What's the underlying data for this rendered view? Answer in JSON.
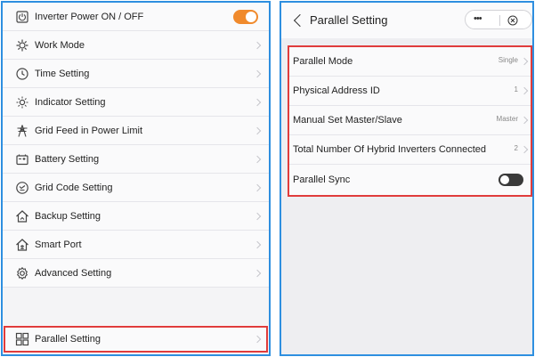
{
  "left_menu": {
    "items": [
      {
        "label": "Inverter Power ON / OFF",
        "icon": "power-button-icon",
        "control": "toggle",
        "toggle_on": true,
        "toggle_color": "#f08a2c"
      },
      {
        "label": "Work Mode",
        "icon": "work-mode-icon"
      },
      {
        "label": "Time Setting",
        "icon": "clock-icon"
      },
      {
        "label": "Indicator Setting",
        "icon": "indicator-light-icon"
      },
      {
        "label": "Grid Feed in Power Limit",
        "icon": "grid-tower-icon"
      },
      {
        "label": "Battery Setting",
        "icon": "battery-icon"
      },
      {
        "label": "Grid Code Setting",
        "icon": "grid-code-icon"
      },
      {
        "label": "Backup Setting",
        "icon": "backup-house-icon"
      },
      {
        "label": "Smart Port",
        "icon": "smart-port-icon"
      },
      {
        "label": "Advanced Setting",
        "icon": "advanced-gear-icon"
      },
      {
        "label": "Parallel Setting",
        "icon": "parallel-icon",
        "highlighted": true
      }
    ]
  },
  "parallel_page": {
    "title": "Parallel Setting",
    "capsule": {
      "more_icon": "more-dots-icon",
      "close_icon": "close-circle-icon"
    },
    "rows": [
      {
        "label": "Parallel Mode",
        "value": "Single"
      },
      {
        "label": "Physical Address ID",
        "value": "1"
      },
      {
        "label": "Manual Set Master/Slave",
        "value": "Master"
      },
      {
        "label": "Total Number Of Hybrid Inverters Connected",
        "value": "2"
      },
      {
        "label": "Parallel Sync",
        "control": "toggle",
        "toggle_on": false
      }
    ]
  },
  "colors": {
    "panel_border": "#2e8fe0",
    "highlight_border": "#e03c3c",
    "toggle_on": "#f08a2c",
    "toggle_off": "#3a3a3a"
  }
}
